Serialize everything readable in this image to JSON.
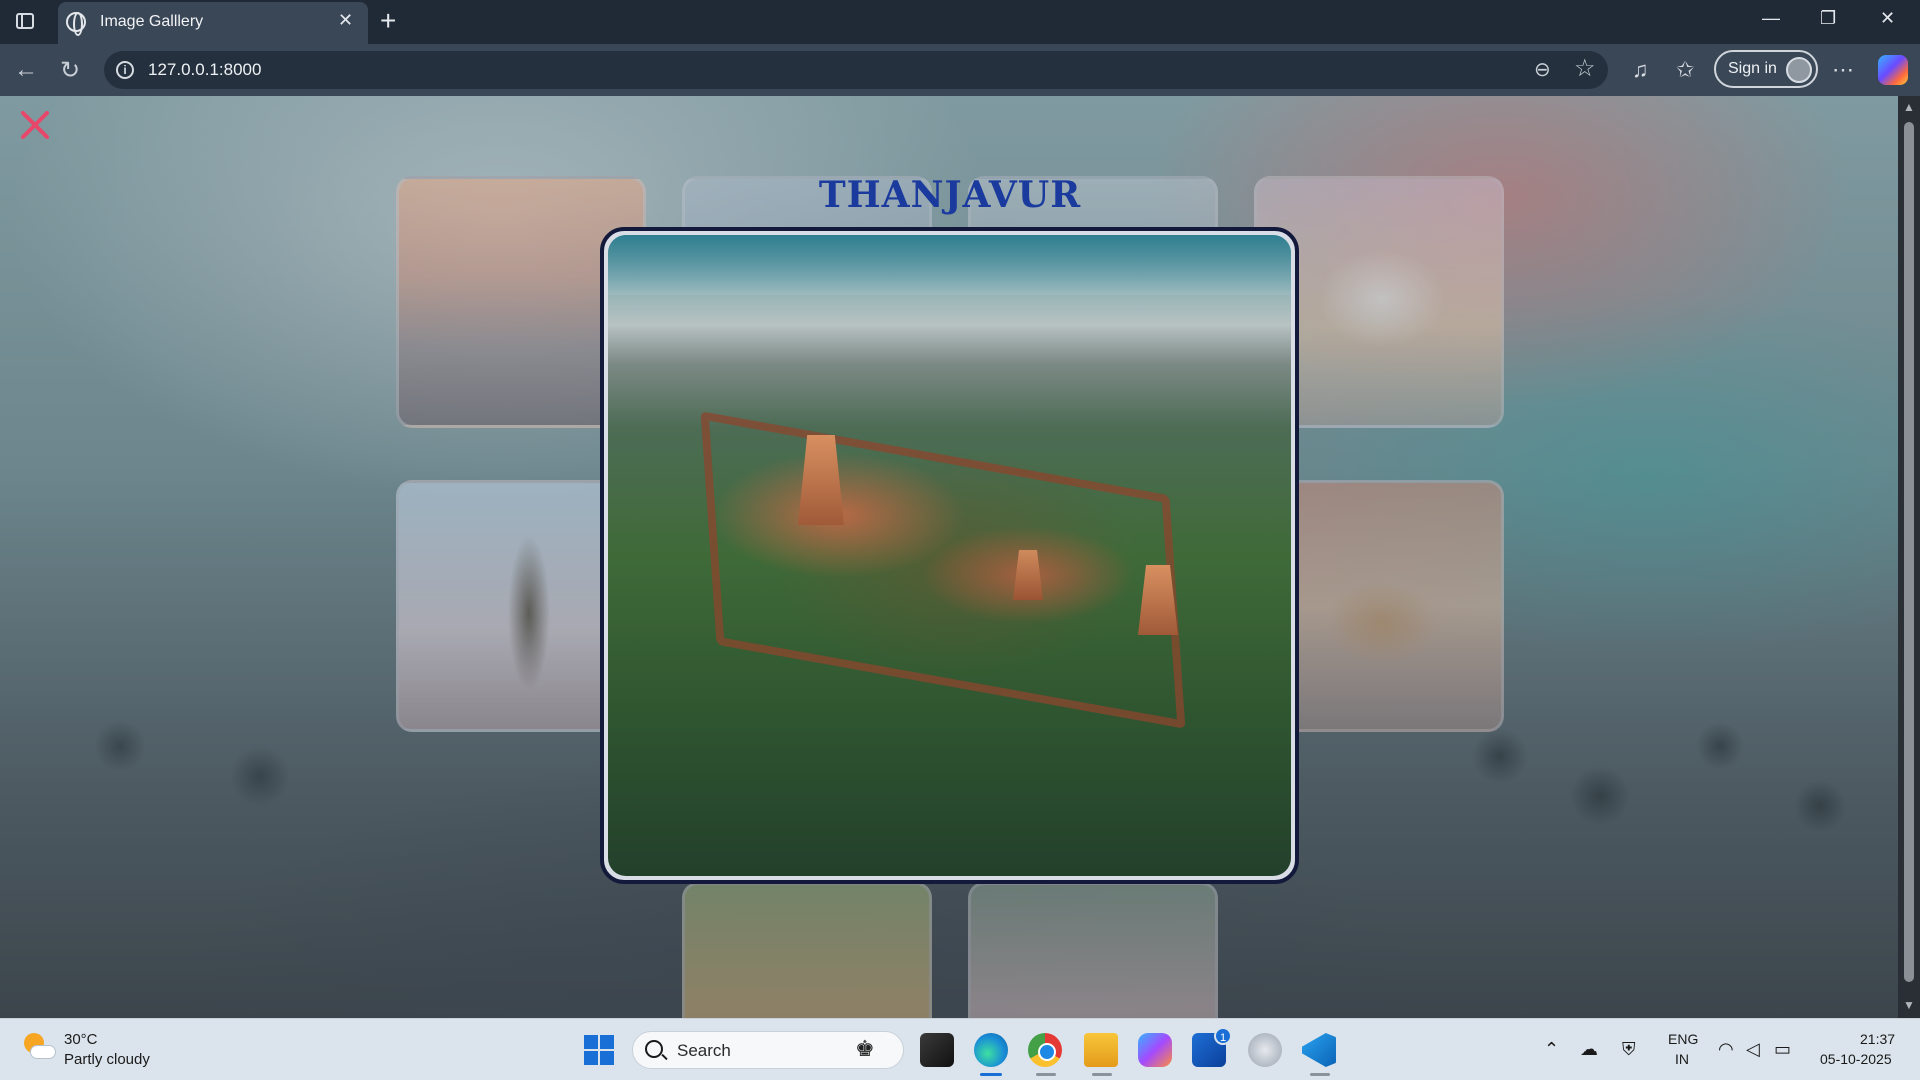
{
  "browser": {
    "tab_title": "Image Galllery",
    "tab_close": "✕",
    "new_tab": "+",
    "url": "127.0.0.1:8000",
    "sign_in": "Sign in",
    "minimize": "—",
    "restore": "❐",
    "close": "✕"
  },
  "gallery": {
    "modal_title": "THANJAVUR",
    "close_icon": "close-x-icon",
    "close_color": "#e8476a"
  },
  "taskbar": {
    "temperature": "30°C",
    "condition": "Partly cloudy",
    "search_label": "Search",
    "store_badge": "1",
    "lang_line1": "ENG",
    "lang_line2": "IN",
    "time": "21:37",
    "date": "05-10-2025"
  }
}
